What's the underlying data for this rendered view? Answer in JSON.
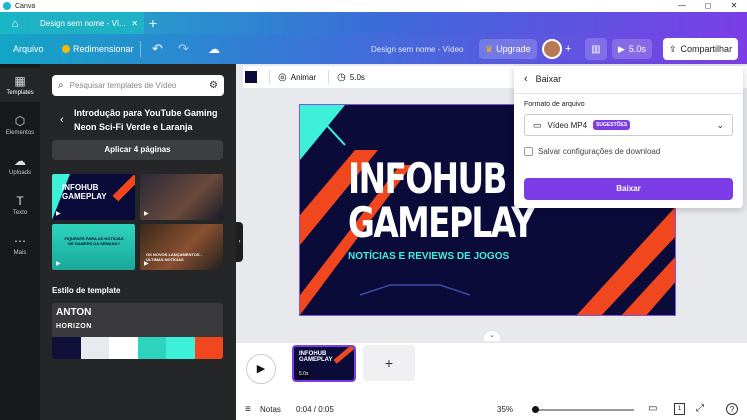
{
  "window": {
    "title": "Canva",
    "min": "—",
    "max": "◻",
    "close": "✕"
  },
  "tab": {
    "label": "Design sem nome - Ví...",
    "close": "✕",
    "new": "+"
  },
  "toolbar": {
    "file": "Arquivo",
    "resize": "Redimensionar",
    "doc_title": "Design sem nome - Vídeo",
    "upgrade": "Upgrade",
    "timer": "5.0s",
    "share": "Compartilhar"
  },
  "rail": [
    {
      "label": "Templates",
      "icon": "▦"
    },
    {
      "label": "Elementos",
      "icon": "⬡"
    },
    {
      "label": "Uploads",
      "icon": "☁"
    },
    {
      "label": "Texto",
      "icon": "T"
    },
    {
      "label": "Mais",
      "icon": "⋯"
    }
  ],
  "panel": {
    "search_placeholder": "Pesquisar templates de Vídeo",
    "template_title": "Introdução para YouTube Gaming Neon Sci-Fi Verde e Laranja",
    "apply": "Aplicar 4 páginas",
    "thumbs": [
      {
        "text": "INFOHUB GAMEPLAY"
      },
      {
        "text": ""
      },
      {
        "text": "FIQUENTE PARA AS NOTÍCIAS DE GAMERS DA SEMANA?"
      },
      {
        "text": "OS NOVOS LANÇAMENTOS - ÚLTIMAS NOTÍCIAS"
      }
    ],
    "style_label": "Estilo de template",
    "style_font1": "ANTON",
    "style_font2": "HORIZON",
    "swatches": [
      "#10103a",
      "#e9eaf0",
      "#ffffff",
      "#2ed3bd",
      "#3ff0d8",
      "#f0471e"
    ]
  },
  "context": {
    "animate": "Animar",
    "duration": "5.0s"
  },
  "slide": {
    "line1": "INFOHUB",
    "line2": "GAMEPLAY",
    "subtitle": "NOTÍCIAS E REVIEWS DE JOGOS"
  },
  "popup": {
    "back": "Baixar",
    "format_label": "Formato de arquivo",
    "format_value": "Vídeo MP4",
    "badge": "SUGESTÕES",
    "checkbox_label": "Salvar configurações de download",
    "download": "Baixar"
  },
  "timeline": {
    "page_label": "INFOHUB GAMEPLAY",
    "page_time": "5.0s",
    "add": "+"
  },
  "status": {
    "notes": "Notas",
    "time": "0:04 / 0:05",
    "zoom": "35%",
    "page": "1"
  },
  "colors": {
    "accent": "#7d3de6",
    "orange": "#f0471e",
    "teal": "#3ff0d8",
    "navy": "#0b0b3a"
  }
}
